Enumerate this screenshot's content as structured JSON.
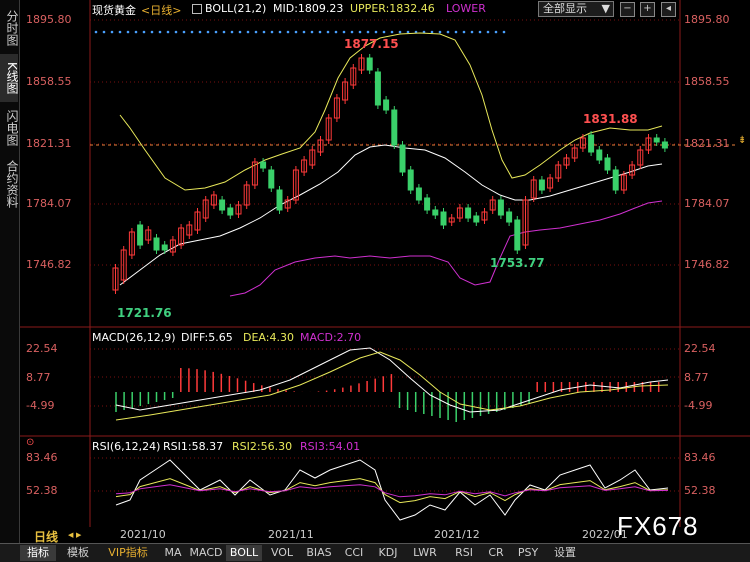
{
  "sidebar": {
    "tabs": [
      {
        "label": "分时图",
        "active": false
      },
      {
        "label": "K线图",
        "active": true
      },
      {
        "label": "闪电图",
        "active": false
      },
      {
        "label": "合约资料",
        "active": false
      }
    ]
  },
  "header": {
    "instrument": "现货黄金",
    "period": "<日线>",
    "boll": "BOLL(21,2)",
    "mid": "MID:1809.23",
    "upper": "UPPER:1832.46",
    "lower": "LOWER",
    "dropdown": "全部显示"
  },
  "main": {
    "yaxis_left": [
      "1895.80",
      "1858.55",
      "1821.31",
      "1784.07",
      "1746.82"
    ],
    "yaxis_right": [
      "1895.80",
      "1858.55",
      "1821.31",
      "1784.07",
      "1746.82"
    ],
    "annotations": {
      "high": "1877.15",
      "low": "1721.76",
      "recent_high": "1831.88",
      "mid_low": "1753.77"
    },
    "current_price": "1821.31"
  },
  "macd": {
    "title": "MACD(26,12,9)",
    "diff": "DIFF:5.65",
    "dea": "DEA:4.30",
    "macd": "MACD:2.70",
    "yaxis": [
      "22.54",
      "8.77",
      "-4.99"
    ]
  },
  "rsi": {
    "title": "RSI(6,12,24)",
    "rsi1": "RSI1:58.37",
    "rsi2": "RSI2:56.30",
    "rsi3": "RSI3:54.01",
    "yaxis": [
      "83.46",
      "52.38"
    ]
  },
  "xaxis": [
    "2021/10",
    "2021/11",
    "2021/12",
    "2022/01"
  ],
  "period_label": "日线",
  "watermark": "FX678",
  "bottom_tabs": [
    {
      "label": "指标",
      "active": true
    },
    {
      "label": "模板",
      "active": false
    },
    {
      "label": "VIP指标",
      "active": false
    },
    {
      "label": "MA",
      "active": false
    },
    {
      "label": "MACD",
      "active": false
    },
    {
      "label": "BOLL",
      "active": true
    },
    {
      "label": "VOL",
      "active": false
    },
    {
      "label": "BIAS",
      "active": false
    },
    {
      "label": "CCI",
      "active": false
    },
    {
      "label": "KDJ",
      "active": false
    },
    {
      "label": "LWR",
      "active": false
    },
    {
      "label": "RSI",
      "active": false
    },
    {
      "label": "CR",
      "active": false
    },
    {
      "label": "PSY",
      "active": false
    },
    {
      "label": "设置",
      "active": false
    }
  ],
  "colors": {
    "up": "#ff3a3a",
    "down": "#3ad06a",
    "upper_band": "#e8e85a",
    "mid_band": "#ffffff",
    "lower_band": "#d030d0",
    "grid": "#7a1010",
    "axis_text": "#d96060",
    "dea": "#e8e85a",
    "macd": "#d030d0",
    "rsi3": "#d030d0"
  }
}
